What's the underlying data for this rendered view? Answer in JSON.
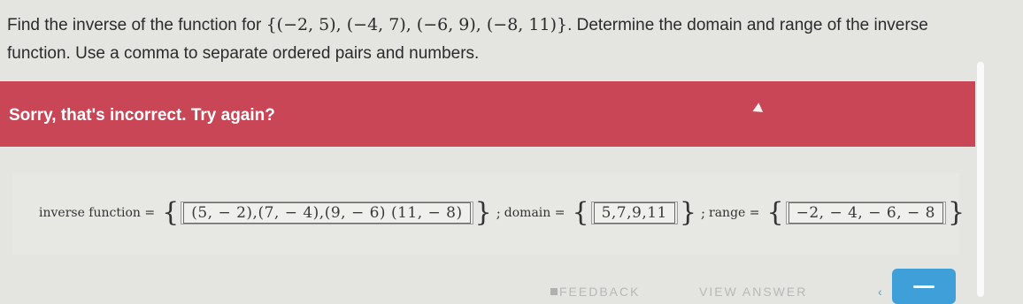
{
  "question": {
    "prefix": "Find the inverse of the function for ",
    "set": "{(−2, 5), (−4, 7), (−6, 9), (−8, 11)}",
    "suffix": ". Determine the domain and range of the inverse function. Use a comma to separate ordered pairs and numbers."
  },
  "feedback_banner": {
    "message": "Sorry, that's incorrect. Try again?"
  },
  "answer": {
    "inverse_label": "inverse function =",
    "inverse_value": "(5, − 2),(7, − 4),(9, − 6) (11, − 8)",
    "domain_label": "domain =",
    "domain_value": "5,7,9,11",
    "range_label": "range =",
    "range_value": "−2, − 4, − 6, − 8",
    "open_brace": "{",
    "close_brace": "}",
    "separator": ";"
  },
  "footer": {
    "feedback_label": "FEEDBACK",
    "view_answer_label": "VIEW ANSWER"
  },
  "colors": {
    "banner": "#c84656",
    "primary_button": "#3f9fd8"
  }
}
